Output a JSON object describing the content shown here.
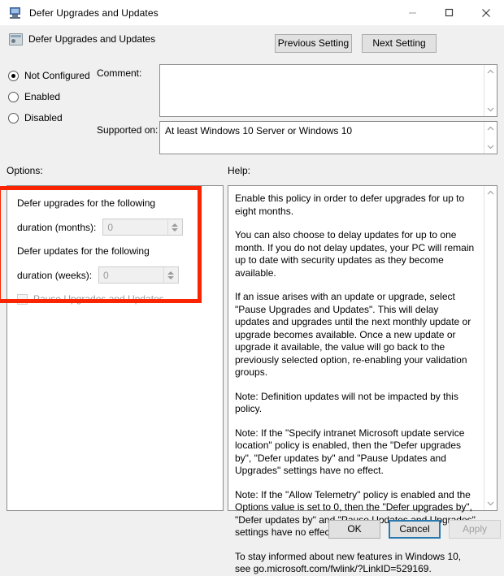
{
  "window": {
    "title": "Defer Upgrades and Updates",
    "icon": "monitor-icon",
    "controls": {
      "minimize": "minimize-icon",
      "maximize": "maximize-icon",
      "close": "close-icon"
    }
  },
  "header": {
    "title": "Defer Upgrades and Updates",
    "icon": "policy-setting-icon",
    "previous_setting": "Previous Setting",
    "next_setting": "Next Setting"
  },
  "state": {
    "options": [
      {
        "label": "Not Configured",
        "selected": true
      },
      {
        "label": "Enabled",
        "selected": false
      },
      {
        "label": "Disabled",
        "selected": false
      }
    ]
  },
  "comment": {
    "label": "Comment:",
    "value": "",
    "placeholder": ""
  },
  "supported_on": {
    "label": "Supported on:",
    "value": "At least Windows 10 Server or Windows 10"
  },
  "options_panel": {
    "label": "Options:",
    "upgrade_text": "Defer upgrades for the following",
    "upgrade_duration_label": "duration (months):",
    "upgrade_duration_value": "0",
    "update_text": "Defer updates for the following",
    "update_duration_label": "duration (weeks):",
    "update_duration_value": "0",
    "pause_checkbox_label": "Pause Upgrades and Updates",
    "pause_checked": false,
    "highlight_color": "#fb2400"
  },
  "help_panel": {
    "label": "Help:",
    "paragraphs": [
      "Enable this policy in order to defer upgrades for up to eight months.",
      "You can also choose to delay updates for up to one month. If you do not delay updates, your PC will remain up to date with security updates as they become available.",
      "If an issue arises with an update or upgrade, select \"Pause Upgrades and Updates\". This will delay updates and upgrades until the next monthly update or upgrade becomes available. Once a new update or upgrade it available, the value will go back to the previously selected option, re-enabling your validation groups.",
      "Note: Definition updates will not be impacted by this policy.",
      "Note: If the \"Specify intranet Microsoft update service location\" policy is enabled, then the \"Defer upgrades by\", \"Defer updates by\" and \"Pause Updates and Upgrades\" settings have no effect.",
      "Note: If the \"Allow Telemetry\" policy is enabled and the Options value is set to 0, then the \"Defer upgrades by\", \"Defer updates by\" and \"Pause Updates and Upgrades\" settings have no effect.",
      "To stay informed about new features in Windows 10, see go.microsoft.com/fwlink/?LinkID=529169."
    ]
  },
  "footer": {
    "ok": "OK",
    "cancel": "Cancel",
    "apply": "Apply",
    "apply_disabled": true
  }
}
